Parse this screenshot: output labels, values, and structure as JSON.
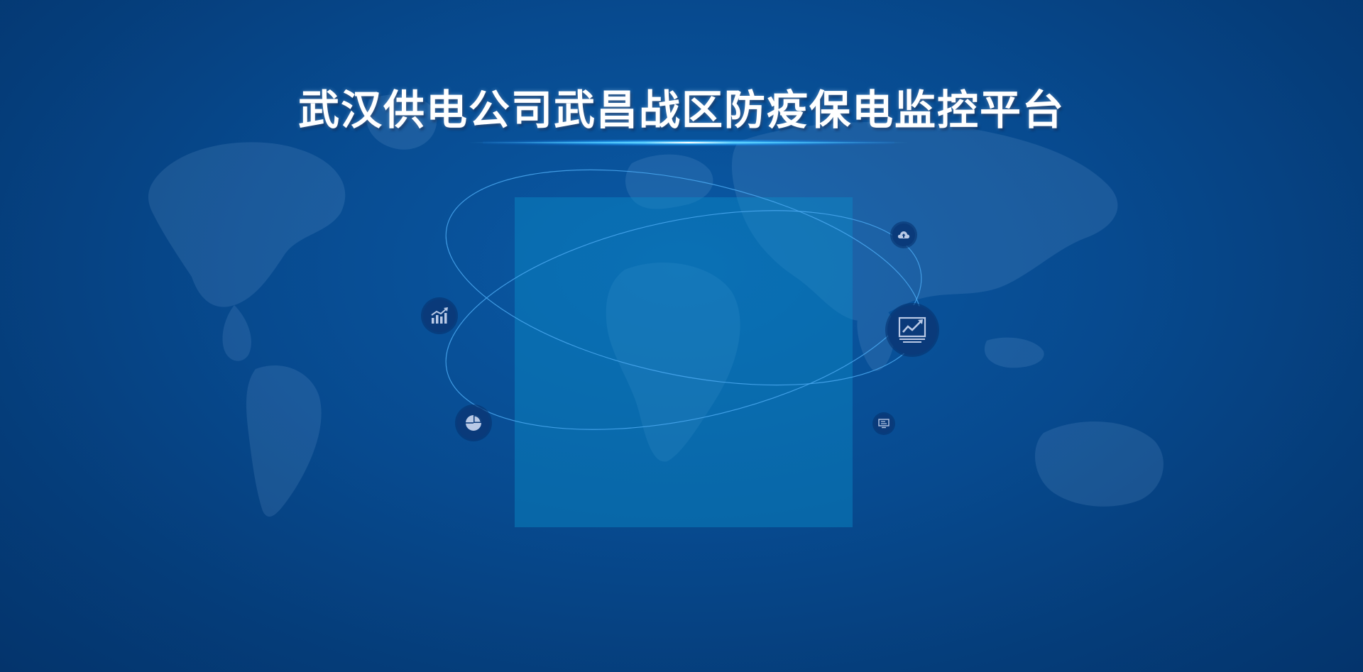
{
  "title": "武汉供电公司武昌战区防疫保电监控平台",
  "colors": {
    "background": "#074a8f",
    "panel": "#0a8cc8",
    "orbit": "#4aa8f0",
    "node": "#0a3a7a",
    "icon": "#b9c9e6"
  },
  "nodes": [
    {
      "icon": "bar-chart-trend-icon"
    },
    {
      "icon": "pie-chart-icon"
    },
    {
      "icon": "cloud-upload-icon"
    },
    {
      "icon": "monitor-trend-icon"
    },
    {
      "icon": "small-monitor-icon"
    }
  ]
}
